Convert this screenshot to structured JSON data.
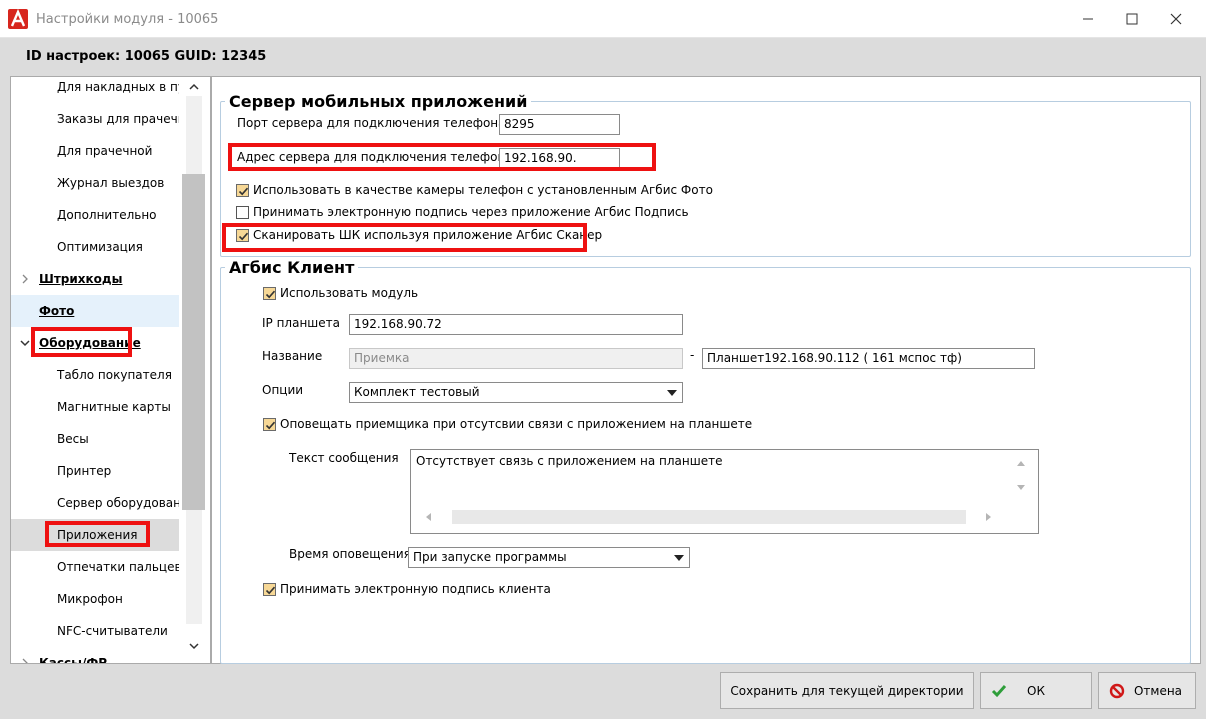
{
  "window": {
    "title": "Настройки модуля  - 10065",
    "id_line": "ID настроек: 10065   GUID: 12345"
  },
  "nav": {
    "items": [
      {
        "label": "Для накладных в пути",
        "kind": "sub"
      },
      {
        "label": "Заказы для прачечной",
        "kind": "sub"
      },
      {
        "label": "Для прачечной",
        "kind": "sub"
      },
      {
        "label": "Журнал выездов",
        "kind": "sub"
      },
      {
        "label": "Дополнительно",
        "kind": "sub"
      },
      {
        "label": "Оптимизация",
        "kind": "sub"
      },
      {
        "label": "Штрихкоды",
        "kind": "group",
        "chevron": "chevron-right-icon"
      },
      {
        "label": "Фото",
        "kind": "group"
      },
      {
        "label": "Оборудование",
        "kind": "group",
        "chevron": "chevron-down-icon"
      },
      {
        "label": "Табло покупателя",
        "kind": "sub"
      },
      {
        "label": "Магнитные карты",
        "kind": "sub"
      },
      {
        "label": "Весы",
        "kind": "sub"
      },
      {
        "label": "Принтер",
        "kind": "sub"
      },
      {
        "label": "Сервер оборудования",
        "kind": "sub"
      },
      {
        "label": "Приложения",
        "kind": "sub",
        "selected": true
      },
      {
        "label": "Отпечатки пальцев",
        "kind": "sub"
      },
      {
        "label": "Микрофон",
        "kind": "sub"
      },
      {
        "label": "NFC-считыватели",
        "kind": "sub"
      },
      {
        "label": "Кассы/ФР",
        "kind": "group",
        "chevron": "chevron-right-icon"
      }
    ]
  },
  "mobile_server": {
    "legend": "Сервер мобильных приложений",
    "port_label": "Порт сервера для подключения телефона:",
    "port_value": "8295",
    "address_label": "Адрес сервера для подключения телефона:",
    "address_value": "192.168.90.",
    "use_camera_label": "Использовать в качестве камеры телефон с установленным Агбис Фото",
    "use_camera_checked": true,
    "accept_signature_label": "Принимать электронную подпись через приложение Агбис Подпись",
    "accept_signature_checked": false,
    "scan_barcode_label": "Сканировать ШК используя приложение Агбис Сканер",
    "scan_barcode_checked": true
  },
  "agbis_client": {
    "legend": "Агбис Клиент",
    "use_module_label": "Использовать модуль",
    "use_module_checked": true,
    "ip_label": "IP планшета",
    "ip_value": "192.168.90.72",
    "name_label": "Название",
    "name_value": "Приемка",
    "name_separator": "-",
    "name_suffix": "Планшет192.168.90.112 ( 161 мспос тф)",
    "options_label": "Опции",
    "options_value": "Комплект тестовый",
    "notify_label": "Оповещать приемщика при отсутсвии связи с приложением на планшете",
    "notify_checked": true,
    "message_label": "Текст сообщения",
    "message_value": "Отсутствует связь с приложением на планшете",
    "notify_time_label": "Время оповещения",
    "notify_time_value": "При запуске программы",
    "client_signature_label": "Принимать электронную подпись клиента",
    "client_signature_checked": true
  },
  "buttons": {
    "save_dir": "Сохранить для текущей директории",
    "ok": "ОК",
    "cancel": "Отмена"
  },
  "colors": {
    "highlight_red": "#e11111",
    "checkbox_checked": "#f7d896",
    "ok_icon": "#2e9e3a",
    "cancel_icon": "#d01818"
  }
}
